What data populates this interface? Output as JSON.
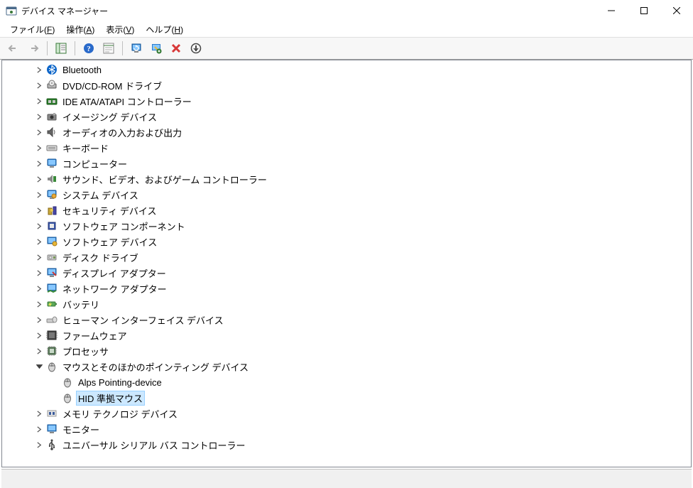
{
  "window": {
    "title": "デバイス マネージャー"
  },
  "menu": {
    "file": {
      "label": "ファイル",
      "key": "F"
    },
    "action": {
      "label": "操作",
      "key": "A"
    },
    "view": {
      "label": "表示",
      "key": "V"
    },
    "help": {
      "label": "ヘルプ",
      "key": "H"
    }
  },
  "toolbar": {
    "back": "back-icon",
    "forward": "forward-icon",
    "show_hide": "show-hide-tree-icon",
    "help": "help-icon",
    "properties": "properties-icon",
    "update_driver": "update-driver-icon",
    "scan": "scan-hardware-icon",
    "uninstall": "uninstall-icon",
    "disable": "disable-icon"
  },
  "tree": {
    "items": [
      {
        "icon": "bluetooth-icon",
        "label": "Bluetooth",
        "expandable": true
      },
      {
        "icon": "dvd-drive-icon",
        "label": "DVD/CD-ROM ドライブ",
        "expandable": true
      },
      {
        "icon": "ide-controller-icon",
        "label": "IDE ATA/ATAPI コントローラー",
        "expandable": true
      },
      {
        "icon": "imaging-device-icon",
        "label": "イメージング デバイス",
        "expandable": true
      },
      {
        "icon": "audio-io-icon",
        "label": "オーディオの入力および出力",
        "expandable": true
      },
      {
        "icon": "keyboard-icon",
        "label": "キーボード",
        "expandable": true
      },
      {
        "icon": "computer-icon",
        "label": "コンピューター",
        "expandable": true
      },
      {
        "icon": "sound-video-game-icon",
        "label": "サウンド、ビデオ、およびゲーム コントローラー",
        "expandable": true
      },
      {
        "icon": "system-device-icon",
        "label": "システム デバイス",
        "expandable": true
      },
      {
        "icon": "security-device-icon",
        "label": "セキュリティ デバイス",
        "expandable": true
      },
      {
        "icon": "software-component-icon",
        "label": "ソフトウェア コンポーネント",
        "expandable": true
      },
      {
        "icon": "software-device-icon",
        "label": "ソフトウェア デバイス",
        "expandable": true
      },
      {
        "icon": "disk-drive-icon",
        "label": "ディスク ドライブ",
        "expandable": true
      },
      {
        "icon": "display-adapter-icon",
        "label": "ディスプレイ アダプター",
        "expandable": true
      },
      {
        "icon": "network-adapter-icon",
        "label": "ネットワーク アダプター",
        "expandable": true
      },
      {
        "icon": "battery-icon",
        "label": "バッテリ",
        "expandable": true
      },
      {
        "icon": "hid-icon",
        "label": "ヒューマン インターフェイス デバイス",
        "expandable": true
      },
      {
        "icon": "firmware-icon",
        "label": "ファームウェア",
        "expandable": true
      },
      {
        "icon": "processor-icon",
        "label": "プロセッサ",
        "expandable": true
      },
      {
        "icon": "mouse-icon",
        "label": "マウスとそのほかのポインティング デバイス",
        "expandable": true,
        "expanded": true,
        "children": [
          {
            "icon": "mouse-icon",
            "label": "Alps Pointing-device"
          },
          {
            "icon": "mouse-icon",
            "label": "HID 準拠マウス",
            "selected": true
          }
        ]
      },
      {
        "icon": "memory-tech-icon",
        "label": "メモリ テクノロジ デバイス",
        "expandable": true
      },
      {
        "icon": "monitor-icon",
        "label": "モニター",
        "expandable": true
      },
      {
        "icon": "usb-controller-icon",
        "label": "ユニバーサル シリアル バス コントローラー",
        "expandable": true
      }
    ]
  }
}
